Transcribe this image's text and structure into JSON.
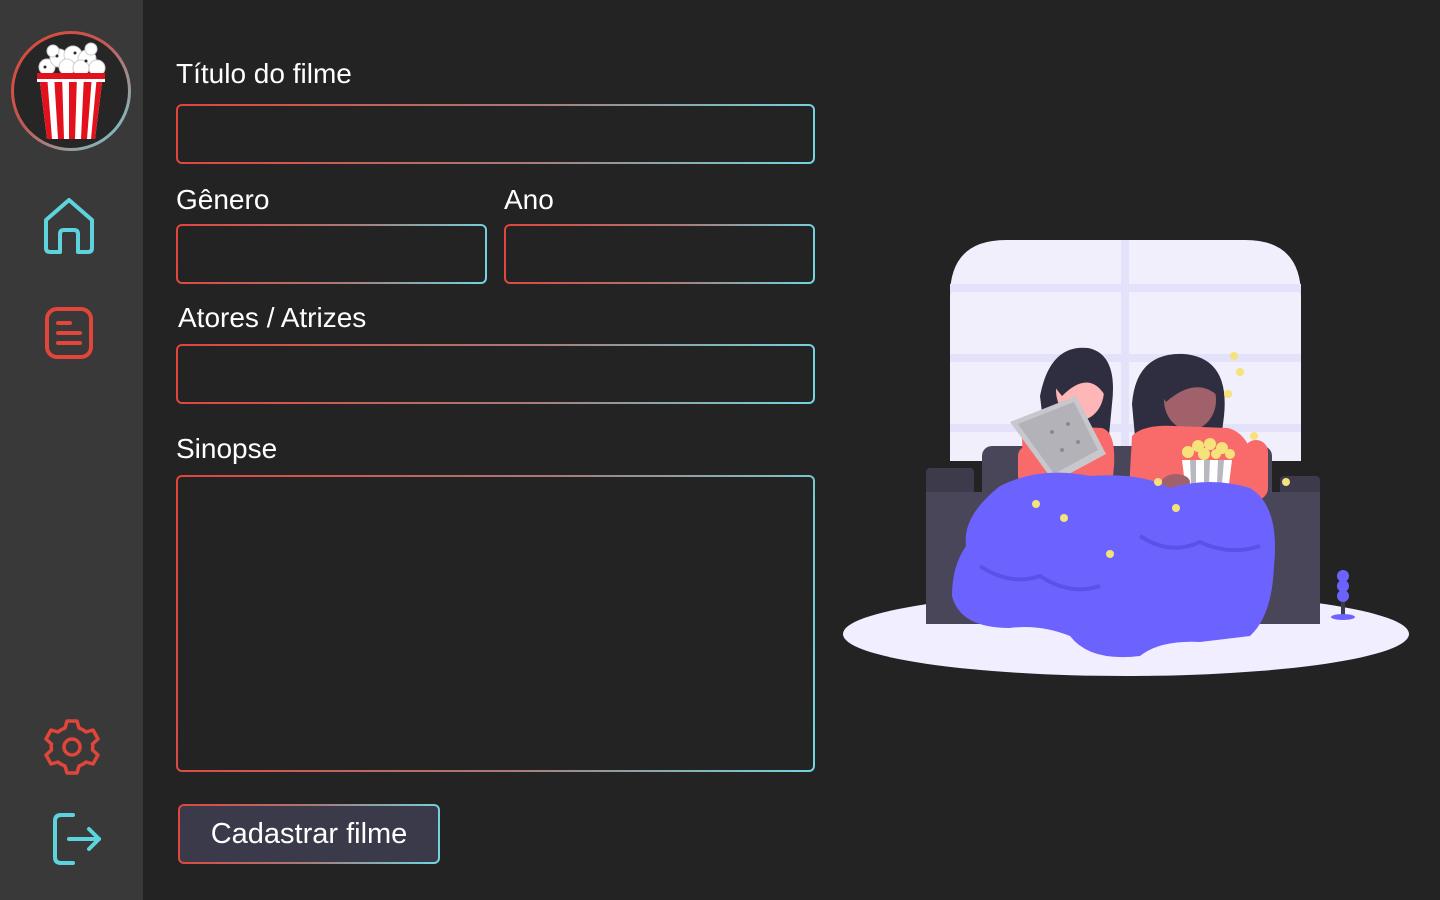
{
  "sidebar": {
    "logo_icon": "popcorn-logo-icon",
    "nav": [
      {
        "name": "home",
        "icon": "home-icon",
        "color": "#5ed3dd"
      },
      {
        "name": "list",
        "icon": "document-list-icon",
        "color": "#e2453a"
      },
      {
        "name": "settings",
        "icon": "gear-icon",
        "color": "#e2453a"
      },
      {
        "name": "logout",
        "icon": "logout-icon",
        "color": "#5ed3dd"
      }
    ]
  },
  "form": {
    "title_label": "Título do filme",
    "title_value": "",
    "genre_label": "Gênero",
    "genre_value": "",
    "year_label": "Ano",
    "year_value": "",
    "cast_label": "Atores / Atrizes",
    "cast_value": "",
    "synopsis_label": "Sinopse",
    "synopsis_value": "",
    "submit_label": "Cadastrar filme"
  },
  "illustration": {
    "name": "two-women-watching-movie-illustration"
  },
  "colors": {
    "background": "#232323",
    "sidebar": "#393939",
    "accent_red": "#e2453a",
    "accent_cyan": "#6fd7e0",
    "button_fill": "#3a3a4a",
    "blanket": "#6c63ff"
  }
}
